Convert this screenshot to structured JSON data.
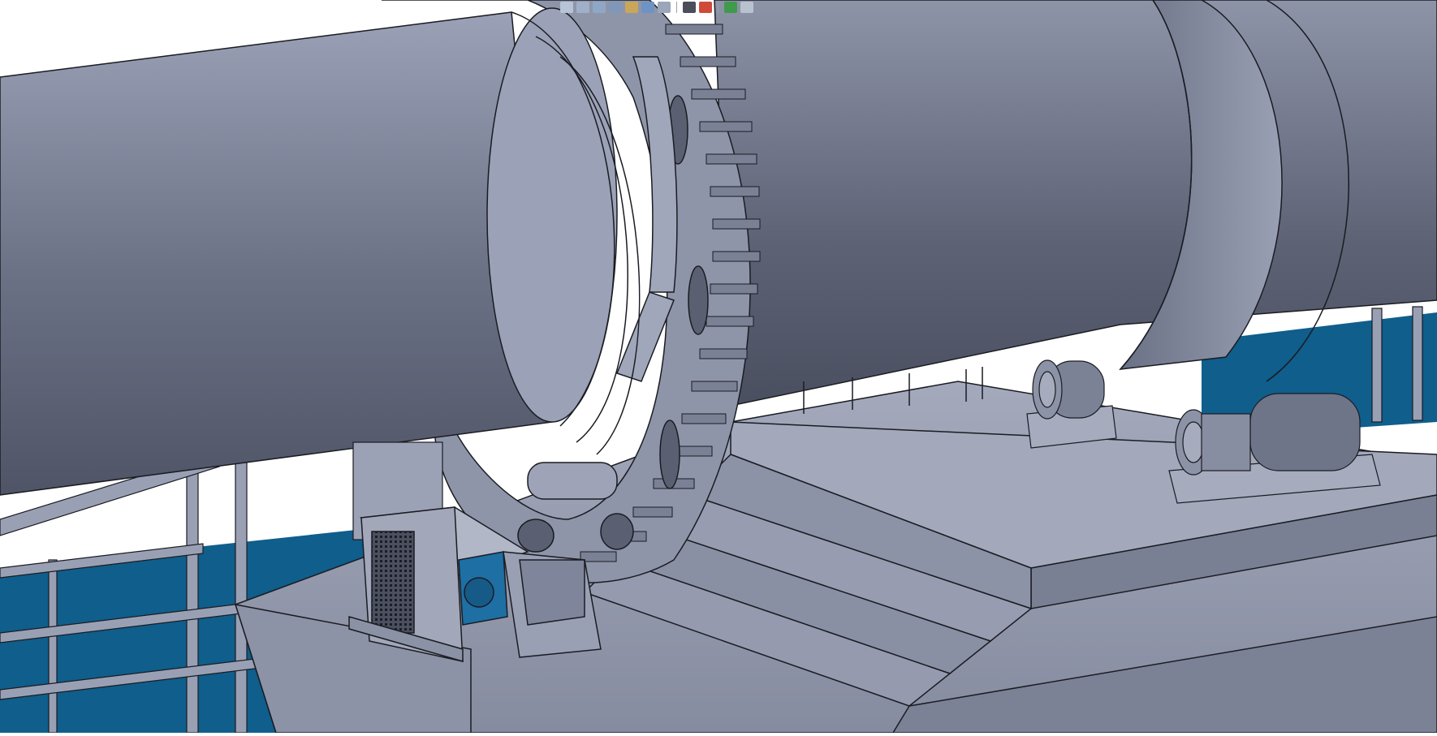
{
  "window": {
    "title": ""
  },
  "toolbar": {
    "buttons": [
      {
        "name": "zoom-icon",
        "color": "#b7c3d6"
      },
      {
        "name": "view-rotate-icon",
        "color": "#9fb0c8"
      },
      {
        "name": "pan-icon",
        "color": "#8fa7c6"
      },
      {
        "name": "fit-all-icon",
        "color": "#7f97b8"
      },
      {
        "name": "normal-view-icon",
        "color": "#c8a75a"
      },
      {
        "name": "multi-view-icon",
        "color": "#6f93c4"
      },
      {
        "name": "iso-view-icon",
        "color": "#9aa6b9"
      },
      {
        "name": "shading-icon",
        "color": "#4a4f5a"
      },
      {
        "name": "hide-show-icon",
        "color": "#d04a3a"
      },
      {
        "name": "swap-visible-space-icon",
        "color": "#3f9a4c"
      },
      {
        "name": "display-options-icon",
        "color": "#b9c2cf"
      }
    ]
  },
  "scene": {
    "colors": {
      "background": "#ffffff",
      "steel_light": "#9aa0b4",
      "steel_mid": "#7d8499",
      "steel_dark": "#5a6072",
      "edge": "#1a1c22",
      "blue_wall": "#0f5e8c",
      "motor_blue": "#1d6fa4"
    }
  }
}
